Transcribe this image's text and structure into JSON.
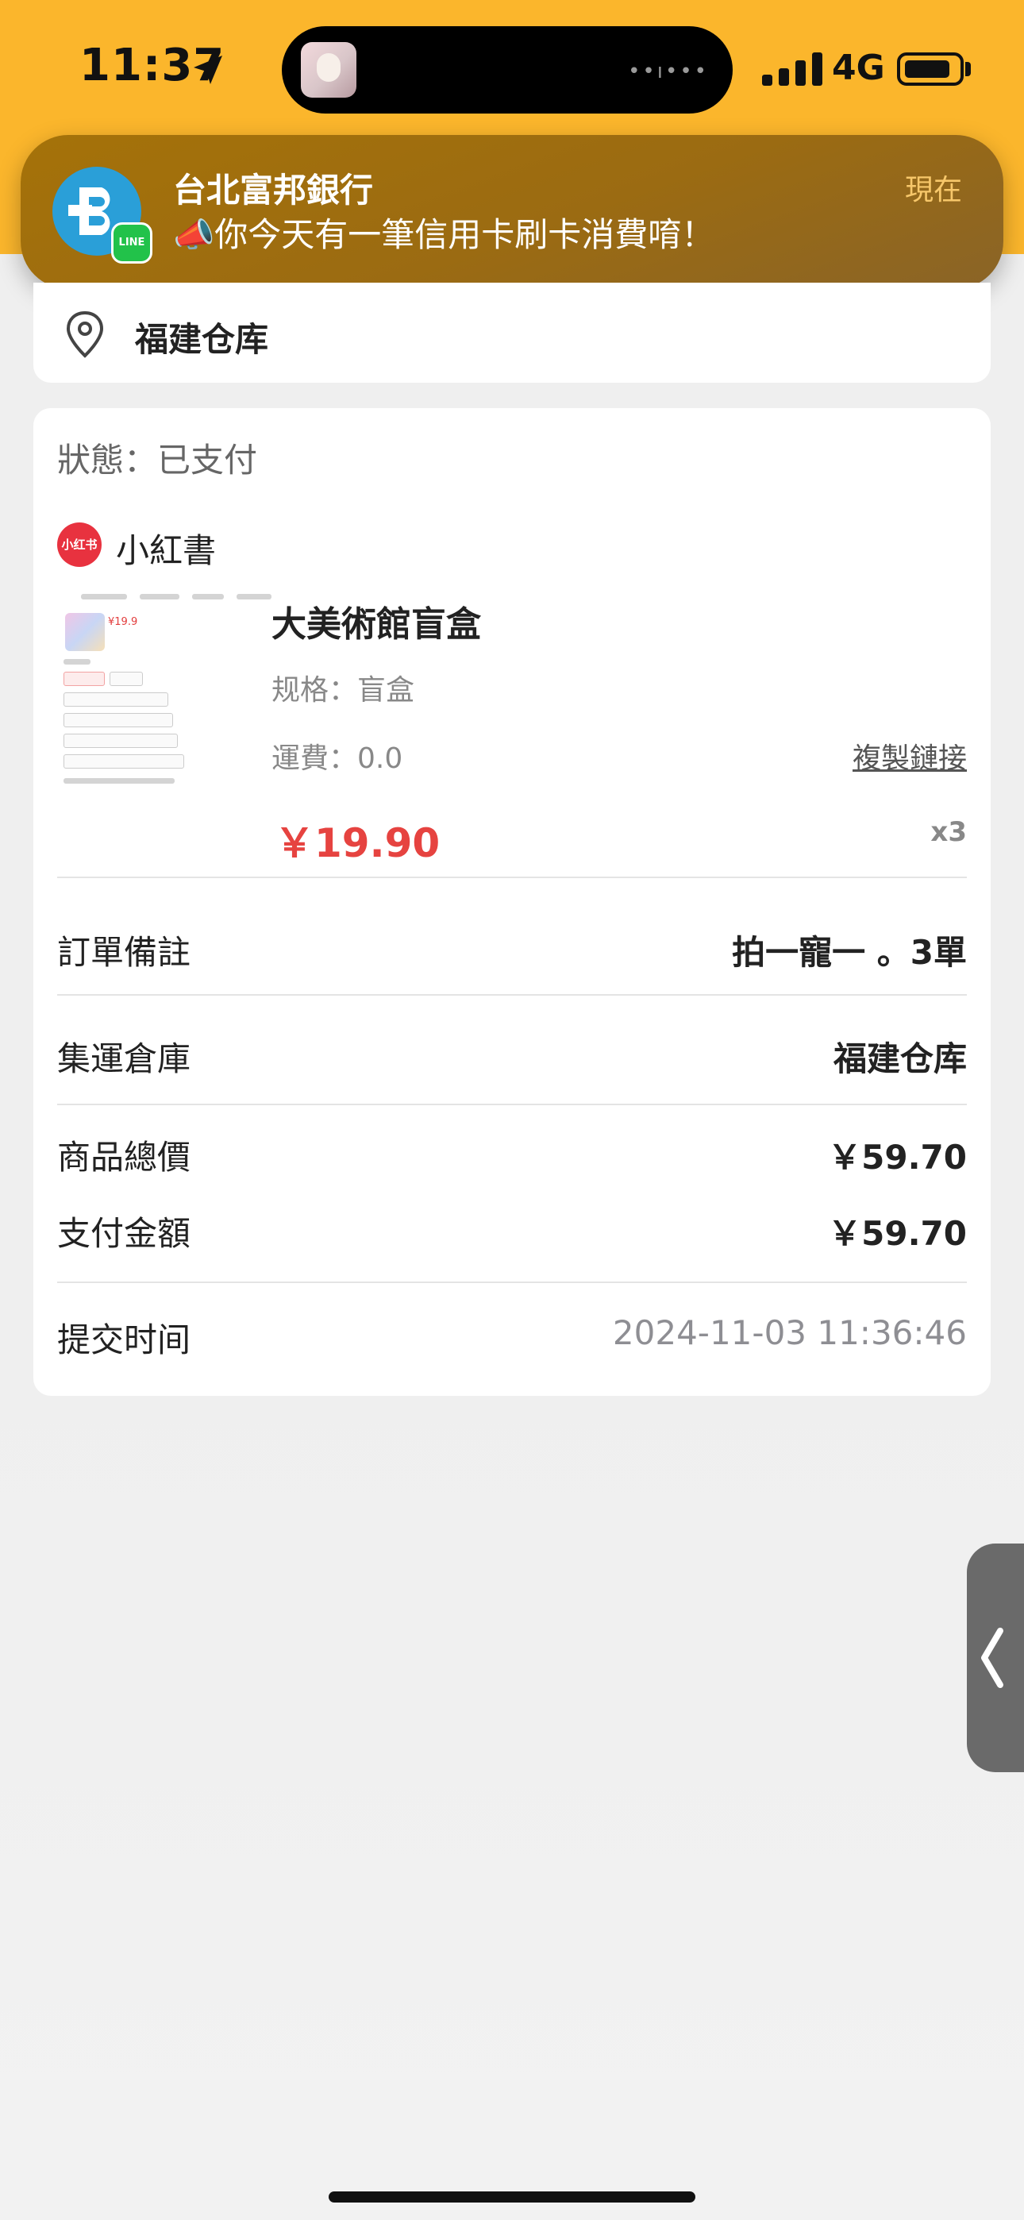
{
  "status_bar": {
    "time": "11:37",
    "network": "4G"
  },
  "notification": {
    "title": "台北富邦銀行",
    "body": "📣你今天有一筆信用卡刷卡消費唷！",
    "time": "現在",
    "badge": "LINE"
  },
  "address": {
    "name": "福建仓库"
  },
  "order": {
    "status": "狀態：已支付",
    "shop": {
      "name": "小紅書",
      "logo_text": "小红书"
    },
    "product": {
      "thumb_price": "¥19.9",
      "title": "大美術館盲盒",
      "spec": "规格：盲盒",
      "shipping": "運費：0.0",
      "copy_link": "複製鏈接",
      "price": "￥19.90",
      "quantity": "x3"
    },
    "rows": [
      {
        "label": "訂單備註",
        "value": "拍一寵一 。3單"
      },
      {
        "label": "集運倉庫",
        "value": "福建仓库"
      },
      {
        "label": "商品總價",
        "value": "￥59.70"
      },
      {
        "label": "支付金額",
        "value": "￥59.70"
      },
      {
        "label": "提交时间",
        "value": "2024-11-03 11:36:46"
      }
    ]
  },
  "colors": {
    "header": "#fbb62c",
    "price": "#e64340",
    "notification_bg": "#9b6b12",
    "line_badge": "#22c24a"
  },
  "icons": [
    "location-arrow-icon",
    "signal-icon",
    "battery-icon",
    "location-pin-icon",
    "chevron-left-icon",
    "bank-logo-icon"
  ]
}
